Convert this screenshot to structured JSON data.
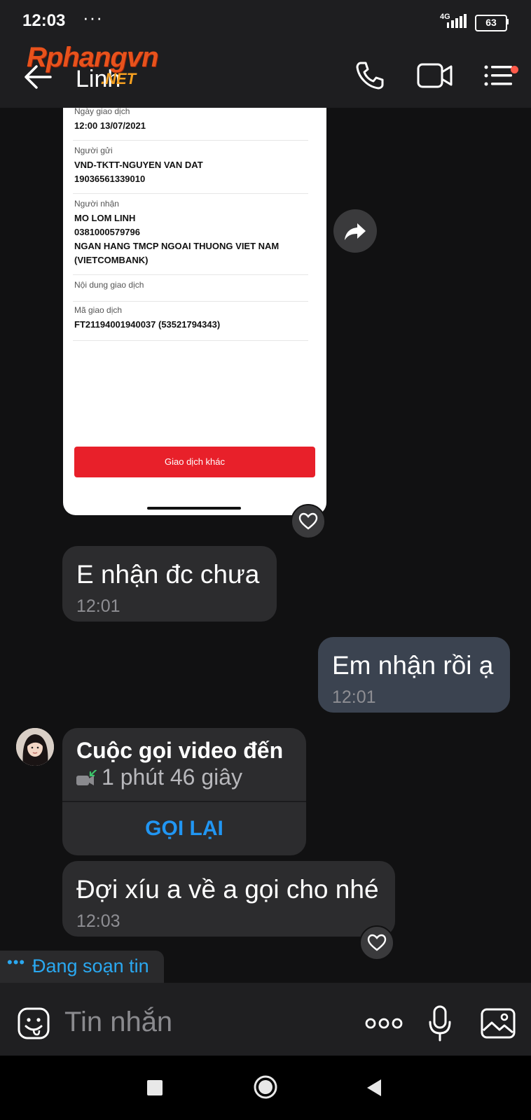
{
  "status_bar": {
    "time": "12:03",
    "dots": "···",
    "network": "4G",
    "battery": "63"
  },
  "header": {
    "contact_name": "Linh",
    "watermark": "Rphangvn",
    "watermark_suffix": ".NET"
  },
  "receipt": {
    "date_label": "Ngày giao dịch",
    "date_value": "12:00 13/07/2021",
    "sender_label": "Người gửi",
    "sender_line1": "VND-TKTT-NGUYEN VAN DAT",
    "sender_line2": "19036561339010",
    "receiver_label": "Người nhận",
    "receiver_line1": "MO LOM LINH",
    "receiver_line2": "0381000579796",
    "receiver_line3": "NGAN HANG TMCP NGOAI THUONG VIET NAM",
    "receiver_line4": "(VIETCOMBANK)",
    "content_label": "Nội dung giao dịch",
    "code_label": "Mã giao dịch",
    "code_value": "FT21194001940037 (53521794343)",
    "other_button": "Giao dịch khác"
  },
  "messages": [
    {
      "direction": "in",
      "text": "E nhận đc chưa",
      "time": "12:01"
    },
    {
      "direction": "out",
      "text": "Em nhận rồi ạ",
      "time": "12:01"
    },
    {
      "direction": "in",
      "text": "Đợi xíu a về a gọi cho nhé",
      "time": "12:03"
    }
  ],
  "call_card": {
    "title": "Cuộc gọi video đến",
    "duration": "1 phút 46 giây",
    "callback_label": "GỌI LẠI"
  },
  "typing": {
    "dots": "•••",
    "text": "Đang soạn tin"
  },
  "composer": {
    "placeholder": "Tin nhắn"
  },
  "colors": {
    "accent": "#2196f3",
    "typing": "#2aa8f0",
    "receipt_button": "#e8202a",
    "badge": "#ff5a4a"
  },
  "icons": [
    "back-arrow-icon",
    "phone-icon",
    "video-camera-icon",
    "menu-list-icon",
    "share-forward-icon",
    "heart-icon",
    "missed-video-call-icon",
    "emoji-icon",
    "more-dots-icon",
    "microphone-icon",
    "gallery-icon"
  ]
}
